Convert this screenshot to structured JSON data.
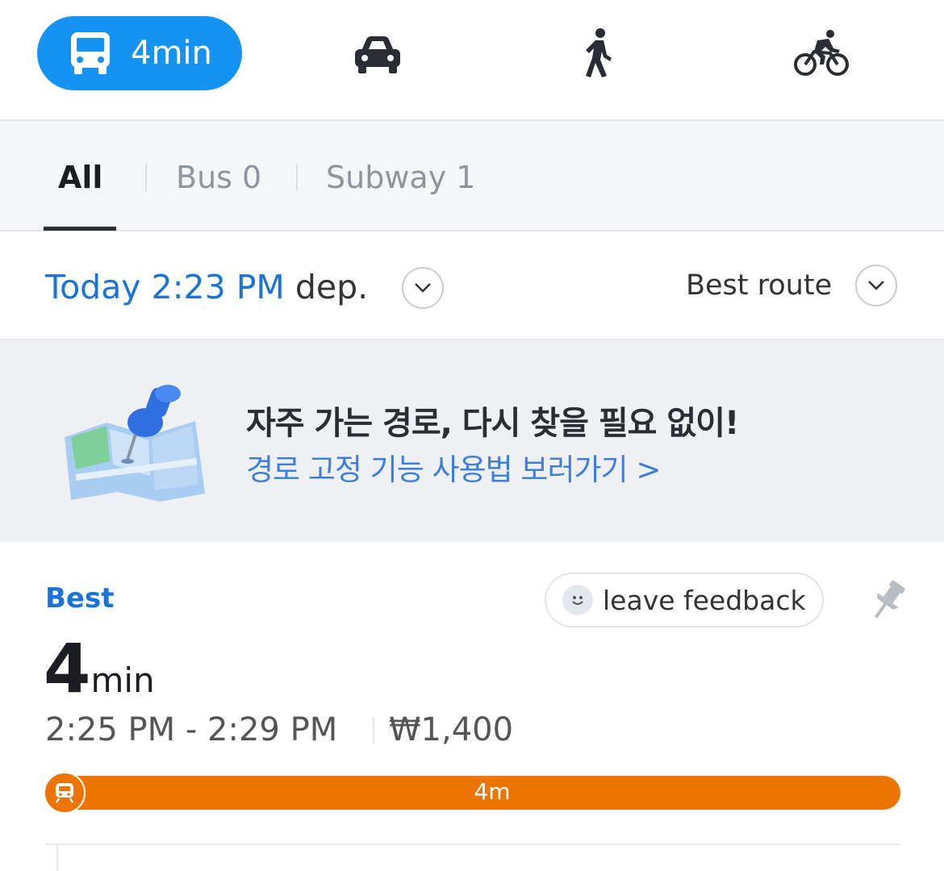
{
  "modes": {
    "transit": {
      "icon": "bus-icon",
      "label": "4min",
      "selected": true
    },
    "car": {
      "icon": "car-icon"
    },
    "walk": {
      "icon": "walking-icon"
    },
    "bike": {
      "icon": "bicycle-icon"
    }
  },
  "filters": {
    "tabs": [
      {
        "label": "All",
        "active": true
      },
      {
        "label": "Bus 0",
        "active": false
      },
      {
        "label": "Subway 1",
        "active": false
      }
    ]
  },
  "departure": {
    "time": "Today 2:23 PM",
    "suffix": "dep.",
    "dropdown_icon": "chevron-down-icon"
  },
  "sort": {
    "label": "Best route",
    "dropdown_icon": "chevron-down-icon"
  },
  "banner": {
    "illustration": "map-pin-illustration",
    "title": "자주 가는 경로, 다시 찾을 필요 없이!",
    "link": "경로 고정 기능 사용법 보러가기 >"
  },
  "route": {
    "badge": "Best",
    "feedback_label": "leave feedback",
    "feedback_icon": "smiley-icon",
    "pin_icon": "pushpin-icon",
    "duration_value": "4",
    "duration_unit": "min",
    "timespan": "2:25 PM - 2:29 PM",
    "fare": "₩1,400",
    "segment": {
      "icon": "subway-icon",
      "label": "4m",
      "color": "#ee7400"
    }
  },
  "colors": {
    "accent": "#1593f5",
    "link_blue": "#1a73d9",
    "subway_orange": "#ee7400"
  }
}
